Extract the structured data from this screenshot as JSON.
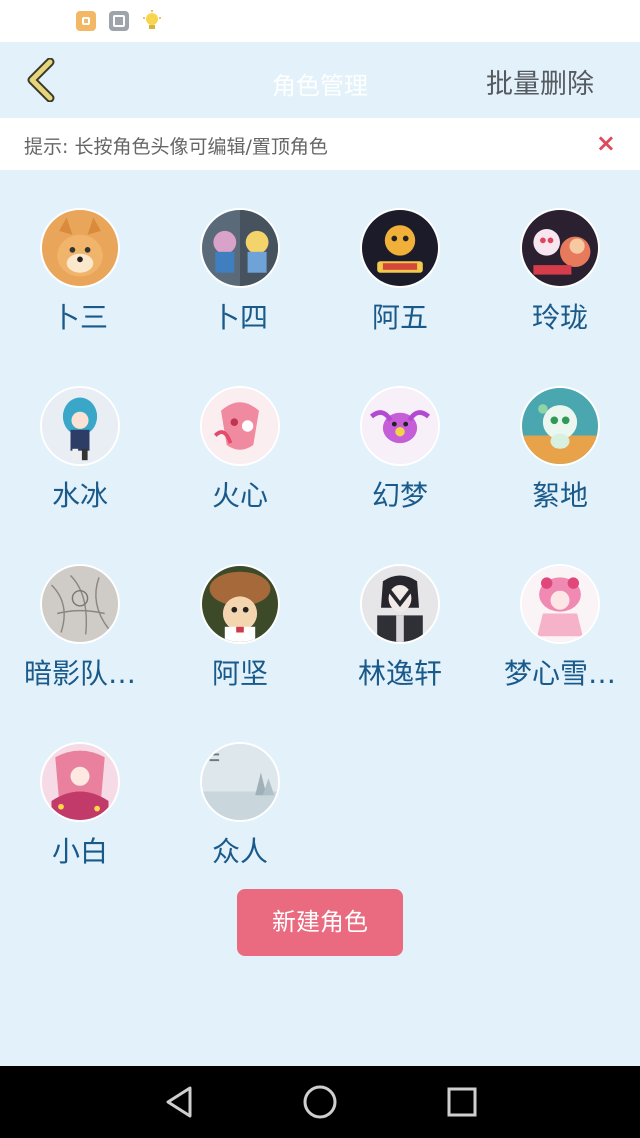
{
  "header": {
    "title": "角色管理",
    "batch_delete": "批量删除",
    "back_icon": "chevron-left-icon"
  },
  "tip": {
    "text": "提示: 长按角色头像可编辑/置顶角色",
    "close": "×"
  },
  "characters": [
    {
      "name": "卜三",
      "avatar": "shiba-dog-avatar"
    },
    {
      "name": "卜四",
      "avatar": "cartoon-duo-avatar"
    },
    {
      "name": "阿五",
      "avatar": "tiger-hero-avatar"
    },
    {
      "name": "玲珑",
      "avatar": "cat-duo-avatar"
    },
    {
      "name": "水冰",
      "avatar": "blue-hair-girl-avatar"
    },
    {
      "name": "火心",
      "avatar": "pink-creature-avatar"
    },
    {
      "name": "幻梦",
      "avatar": "purple-creature-avatar"
    },
    {
      "name": "絮地",
      "avatar": "green-creature-avatar"
    },
    {
      "name": "暗影队…",
      "avatar": "sketch-avatar"
    },
    {
      "name": "阿坚",
      "avatar": "mushroom-dog-avatar"
    },
    {
      "name": "林逸轩",
      "avatar": "dark-hair-boy-avatar"
    },
    {
      "name": "梦心雪…",
      "avatar": "pink-girl-avatar"
    },
    {
      "name": "小白",
      "avatar": "pink-magic-girl-avatar"
    },
    {
      "name": "众人",
      "avatar": "winter-scene-avatar"
    }
  ],
  "new_role_button": "新建角色",
  "nav": {
    "back": "triangle-back-icon",
    "home": "circle-home-icon",
    "recents": "square-recents-icon"
  },
  "colors": {
    "background": "#e2f1fa",
    "accent": "#ea6a80",
    "name_text": "#1a5a8a",
    "close_x": "#e0495a",
    "back_chevron": "#e8d47a"
  }
}
